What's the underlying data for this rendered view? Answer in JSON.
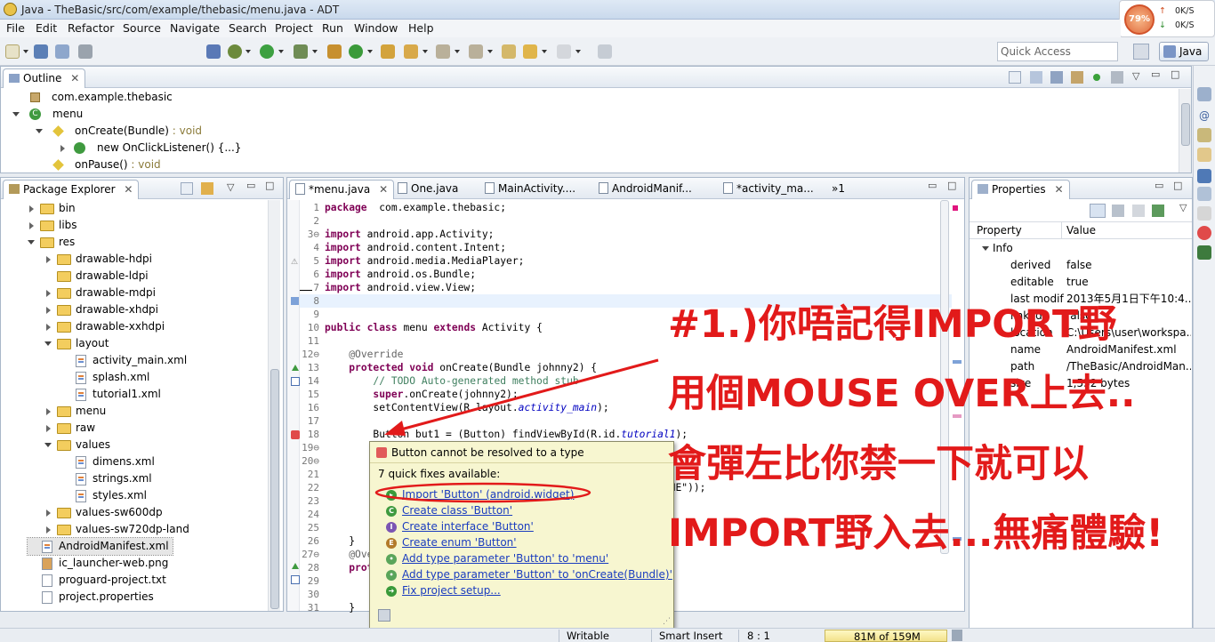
{
  "window": {
    "title": "Java - TheBasic/src/com/example/thebasic/menu.java - ADT",
    "min_glyph": "—",
    "max_glyph": "□",
    "close_glyph": "✕"
  },
  "net_widget": {
    "percent": "79%",
    "up": "0K/S",
    "down": "0K/S",
    "up_arrow": "↑",
    "down_arrow": "↓"
  },
  "menu": [
    "File",
    "Edit",
    "Refactor",
    "Source",
    "Navigate",
    "Search",
    "Project",
    "Run",
    "Window",
    "Help"
  ],
  "toolbar": {
    "quick_access_placeholder": "Quick Access",
    "perspective_label": "Java"
  },
  "outline": {
    "tab_label": "Outline",
    "items": [
      {
        "label": "com.example.thebasic",
        "type": ""
      },
      {
        "label": "menu",
        "type": ""
      },
      {
        "label": "onCreate(Bundle)",
        "type": " : void"
      },
      {
        "label": "new OnClickListener() {...}",
        "type": ""
      },
      {
        "label": "onPause()",
        "type": " : void"
      }
    ]
  },
  "package_explorer": {
    "tab_label": "Package Explorer",
    "items": [
      {
        "label": "bin"
      },
      {
        "label": "libs"
      },
      {
        "label": "res"
      },
      {
        "label": "drawable-hdpi"
      },
      {
        "label": "drawable-ldpi"
      },
      {
        "label": "drawable-mdpi"
      },
      {
        "label": "drawable-xhdpi"
      },
      {
        "label": "drawable-xxhdpi"
      },
      {
        "label": "layout"
      },
      {
        "label": "activity_main.xml"
      },
      {
        "label": "splash.xml"
      },
      {
        "label": "tutorial1.xml"
      },
      {
        "label": "menu"
      },
      {
        "label": "raw"
      },
      {
        "label": "values"
      },
      {
        "label": "dimens.xml"
      },
      {
        "label": "strings.xml"
      },
      {
        "label": "styles.xml"
      },
      {
        "label": "values-sw600dp"
      },
      {
        "label": "values-sw720dp-land"
      },
      {
        "label": "AndroidManifest.xml"
      },
      {
        "label": "ic_launcher-web.png"
      },
      {
        "label": "proguard-project.txt"
      },
      {
        "label": "project.properties"
      }
    ]
  },
  "editor": {
    "tabs": [
      "*menu.java",
      "One.java",
      "MainActivity....",
      "AndroidManif...",
      "*activity_ma...",
      "»1"
    ],
    "lines": [
      {
        "n": "1",
        "parts": [
          [
            "kw",
            "package"
          ],
          [
            "",
            "  com.example.thebasic;"
          ]
        ]
      },
      {
        "n": "2",
        "parts": []
      },
      {
        "n": "3⊖",
        "parts": [
          [
            "kw",
            "import"
          ],
          [
            "",
            " android.app.Activity;"
          ]
        ]
      },
      {
        "n": "4",
        "parts": [
          [
            "kw",
            "import"
          ],
          [
            "",
            " android.content.Intent;"
          ]
        ]
      },
      {
        "n": "5",
        "parts": [
          [
            "kw",
            "import"
          ],
          [
            "",
            " android.media.MediaPlayer;"
          ]
        ]
      },
      {
        "n": "6",
        "parts": [
          [
            "kw",
            "import"
          ],
          [
            "",
            " android.os.Bundle;"
          ]
        ]
      },
      {
        "n": "7",
        "parts": [
          [
            "kw",
            "import"
          ],
          [
            "",
            " android.view.View;"
          ]
        ]
      },
      {
        "n": "8",
        "parts": []
      },
      {
        "n": "9",
        "parts": []
      },
      {
        "n": "10",
        "parts": [
          [
            "kw",
            "public"
          ],
          [
            "",
            " "
          ],
          [
            "kw",
            "class"
          ],
          [
            "",
            " menu "
          ],
          [
            "kw",
            "extends"
          ],
          [
            "",
            " Activity {"
          ]
        ]
      },
      {
        "n": "11",
        "parts": []
      },
      {
        "n": "12⊖",
        "parts": [
          [
            "",
            "    "
          ],
          [
            "ann",
            "@Override"
          ]
        ]
      },
      {
        "n": "13",
        "parts": [
          [
            "",
            "    "
          ],
          [
            "kw",
            "protected"
          ],
          [
            "",
            " "
          ],
          [
            "kw",
            "void"
          ],
          [
            "",
            " onCreate(Bundle johnny2) {"
          ]
        ]
      },
      {
        "n": "14",
        "parts": [
          [
            "",
            "        "
          ],
          [
            "cm",
            "// TODO Auto-generated method stub"
          ]
        ]
      },
      {
        "n": "15",
        "parts": [
          [
            "",
            "        "
          ],
          [
            "kw",
            "super"
          ],
          [
            "",
            ".onCreate(johnny2);"
          ]
        ]
      },
      {
        "n": "16",
        "parts": [
          [
            "",
            "        setContentView(R.layout."
          ],
          [
            "fld",
            "activity_main"
          ],
          [
            "",
            ");"
          ]
        ]
      },
      {
        "n": "17",
        "parts": []
      },
      {
        "n": "18",
        "parts": [
          [
            "",
            "        Button but1 = (Button) findViewById(R.id."
          ],
          [
            "fld",
            "tutorial1"
          ],
          [
            "",
            ");"
          ]
        ]
      },
      {
        "n": "19⊖",
        "parts": []
      },
      {
        "n": "20⊖",
        "parts": []
      },
      {
        "n": "21",
        "parts": []
      },
      {
        "n": "22",
        "parts": [
          [
            "",
            "                                                  basic.ONE\"));"
          ]
        ]
      },
      {
        "n": "23",
        "parts": []
      },
      {
        "n": "24",
        "parts": []
      },
      {
        "n": "25",
        "parts": []
      },
      {
        "n": "26",
        "parts": [
          [
            "",
            "    }"
          ]
        ]
      },
      {
        "n": "27⊖",
        "parts": [
          [
            "",
            "    "
          ],
          [
            "ann",
            "@Ove"
          ]
        ]
      },
      {
        "n": "28",
        "parts": [
          [
            "",
            "    "
          ],
          [
            "kw",
            "prot"
          ]
        ]
      },
      {
        "n": "29",
        "parts": []
      },
      {
        "n": "30",
        "parts": []
      },
      {
        "n": "31",
        "parts": [
          [
            "",
            "    }"
          ]
        ]
      }
    ]
  },
  "quickfix": {
    "header": "Button cannot be resolved to a type",
    "subtitle": "7 quick fixes available:",
    "fixes": [
      {
        "label": "Import 'Button' (android.widget)",
        "icon": "import-icon",
        "glyph": "▸",
        "color": "#3a9a3a"
      },
      {
        "label": "Create class 'Button'",
        "icon": "class-icon",
        "glyph": "C",
        "color": "#3f9a3f"
      },
      {
        "label": "Create interface 'Button'",
        "icon": "interface-icon",
        "glyph": "I",
        "color": "#7b55b3"
      },
      {
        "label": "Create enum 'Button'",
        "icon": "enum-icon",
        "glyph": "E",
        "color": "#b37a2a"
      },
      {
        "label": "Add type parameter 'Button' to 'menu'",
        "icon": "type-param-icon",
        "glyph": "•",
        "color": "#5aa55a"
      },
      {
        "label": "Add type parameter 'Button' to 'onCreate(Bundle)'",
        "icon": "type-param-icon",
        "glyph": "•",
        "color": "#5aa55a"
      },
      {
        "label": "Fix project setup...",
        "icon": "fix-setup-icon",
        "glyph": "➜",
        "color": "#3a9a3a"
      }
    ]
  },
  "properties": {
    "tab_label": "Properties",
    "col_property": "Property",
    "col_value": "Value",
    "group": "Info",
    "rows": [
      {
        "k": "derived",
        "v": "false"
      },
      {
        "k": "editable",
        "v": "true"
      },
      {
        "k": "last modif",
        "v": "2013年5月1日下午10:4..."
      },
      {
        "k": "linked",
        "v": "false"
      },
      {
        "k": "location",
        "v": "C:\\Users\\user\\workspa..."
      },
      {
        "k": "name",
        "v": "AndroidManifest.xml"
      },
      {
        "k": "path",
        "v": "/TheBasic/AndroidMan..."
      },
      {
        "k": "size",
        "v": "1,532 bytes"
      }
    ]
  },
  "annotation": {
    "line1": "#1.)你唔記得IMPORT野",
    "line2": "用個MOUSE OVER上去..",
    "line3": "會彈左比你禁一下就可以",
    "line4": "IMPORT野入去...無痛體驗!",
    "color": "#e21a1a"
  },
  "status": {
    "writable": "Writable",
    "insert_mode": "Smart Insert",
    "position": "8 : 1",
    "memory": "81M of 159M"
  }
}
